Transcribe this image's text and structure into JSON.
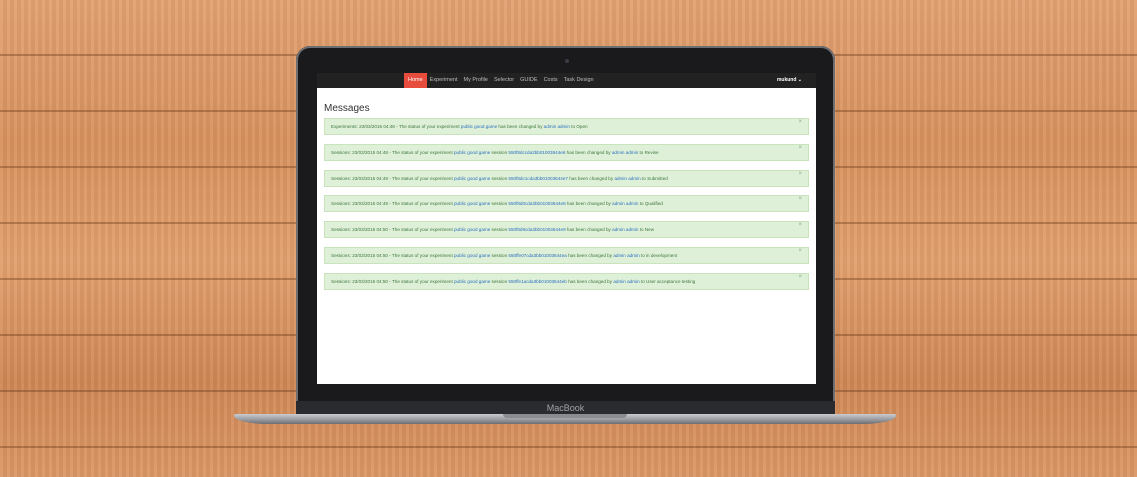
{
  "device": {
    "brand": "MacBook"
  },
  "nav": {
    "items": [
      "Home",
      "Experiment",
      "My Profile",
      "Selector",
      "GUIDE",
      "Costs",
      "Task Design"
    ],
    "active_index": 0,
    "user": "mukund",
    "user_caret": "⌄"
  },
  "page": {
    "title": "Messages"
  },
  "messages": [
    {
      "prefix": "Experiments: 23/03/2015 04:48 - The status of your experiment ",
      "experiment": "public good game",
      "session_text": "",
      "session_id": "",
      "middle": " has been changed by ",
      "user": "admin admin",
      "suffix": " to Open",
      "close": "×"
    },
    {
      "prefix": "Sessions: 23/03/2015 04:48 - The status of your experiment ",
      "experiment": "public good game",
      "session_text": " session ",
      "session_id": "550f8dccda3bb01003644e6",
      "middle": " has been changed by ",
      "user": "admin admin",
      "suffix": " to Revise",
      "close": "×"
    },
    {
      "prefix": "Sessions: 23/03/2015 04:49 - The status of your experiment ",
      "experiment": "public good game",
      "session_text": " session ",
      "session_id": "550f8dc1cda3bb01003644e7",
      "middle": " has been changed by ",
      "user": "admin admin",
      "suffix": " to Submitted",
      "close": "×"
    },
    {
      "prefix": "Sessions: 23/03/2015 04:49 - The status of your experiment ",
      "experiment": "public good game",
      "session_text": " session ",
      "session_id": "550f8d0cda3bb01003644e8",
      "middle": " has been changed by ",
      "user": "admin admin",
      "suffix": " to Qualified",
      "close": "×"
    },
    {
      "prefix": "Sessions: 23/03/2015 04:50 - The status of your experiment ",
      "experiment": "public good game",
      "session_text": " session ",
      "session_id": "550f8d9cda3bb01003644e9",
      "middle": " has been changed by ",
      "user": "admin admin",
      "suffix": " to New",
      "close": "×"
    },
    {
      "prefix": "Sessions: 23/03/2015 04:50 - The status of your experiment ",
      "experiment": "public good game",
      "session_text": " session ",
      "session_id": "550ffe07cda3bb01003644ea",
      "middle": " has been changed by ",
      "user": "admin admin",
      "suffix": " to in development",
      "close": "×"
    },
    {
      "prefix": "Sessions: 23/03/2015 04:50 - The status of your experiment ",
      "experiment": "public good game",
      "session_text": " session ",
      "session_id": "550ffe1acda3bb01003644eb",
      "middle": " has been changed by ",
      "user": "admin admin",
      "suffix": " to User acceptance testing",
      "close": "×"
    }
  ],
  "colors": {
    "accent": "#e74c3c",
    "navbar": "#222222",
    "alert_bg": "#dff0d8",
    "alert_text": "#3c763d",
    "link": "#2a6fbf"
  }
}
